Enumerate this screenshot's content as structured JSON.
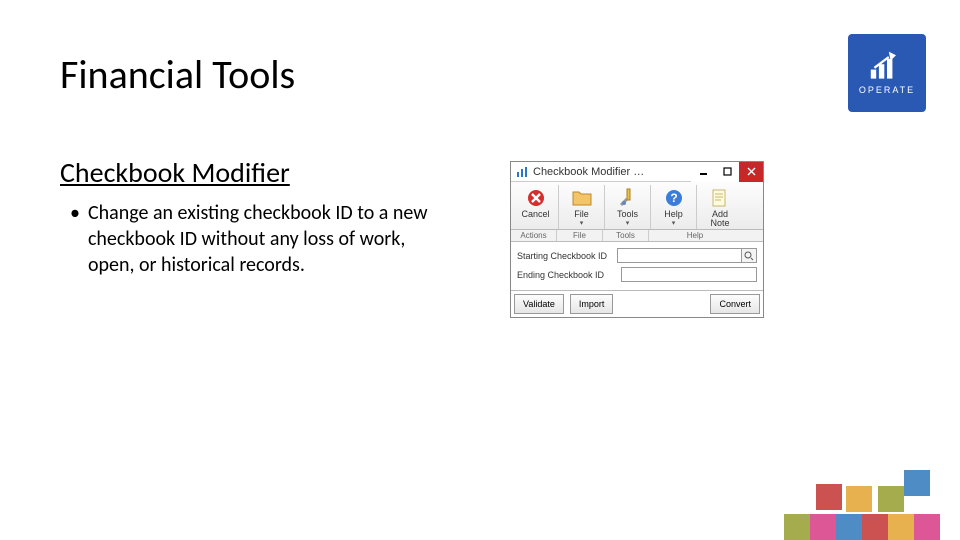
{
  "slide": {
    "title": "Financial Tools",
    "subtitle": "Checkbook Modifier",
    "bullet": "Change an existing checkbook ID to a new checkbook ID without any loss of work, open, or historical records.",
    "badge": "OPERATE"
  },
  "window": {
    "title": "Checkbook Modifier …",
    "ribbon": {
      "cancel": "Cancel",
      "file": "File",
      "tools": "Tools",
      "help": "Help",
      "add": "Add",
      "note": "Note"
    },
    "groups": {
      "actions": "Actions",
      "file": "File",
      "tools": "Tools",
      "help": "Help"
    },
    "form": {
      "start_label": "Starting Checkbook ID",
      "start_value": "",
      "end_label": "Ending Checkbook ID",
      "end_value": ""
    },
    "buttons": {
      "validate": "Validate",
      "import": "Import",
      "convert": "Convert"
    }
  }
}
